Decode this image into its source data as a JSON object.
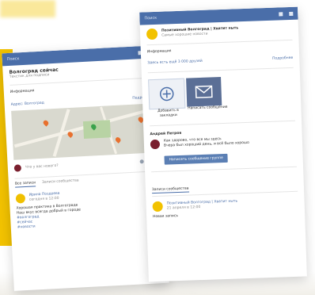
{
  "left_phone": {
    "topbar": {
      "search": "Поиск"
    },
    "community_title": "Волгоград сейчас",
    "community_subtitle": "Текстик для подписи",
    "info_label": "Информация",
    "address": "Адрес: Волгоград",
    "details_link": "Подробнее",
    "post_placeholder": "Что у вас нового?",
    "tabs": [
      "Все записи",
      "Записи сообщества"
    ],
    "post_author": "Ирина Поздеева",
    "post_time": "сегодня в 12:00",
    "post_lines": [
      "Хорошая практика в Волгограде",
      "Наш вкус всегда добрый в городе",
      "#волгоград",
      "#сейчас",
      "#новости"
    ],
    "colors": {
      "header": "#4a6ea9",
      "accent": "#f2c200"
    }
  },
  "right_phone": {
    "topbar": {
      "search": "Поиск"
    },
    "community_title": "Позитивный Волгоград | Хватит ныть",
    "community_subtitle": "Самые хорошие новости",
    "info_label": "Информация",
    "members_line": "Здесь есть ещё 3 000 друзей",
    "details_link": "Подробнее",
    "action_add": "Добавить в закладки",
    "action_message": "Написать сообщение",
    "comment_author": "Андрей Петров",
    "comment_lines": [
      "Как здорово, что все мы здесь",
      "Вчера был хороший день, и всё было хорошо"
    ],
    "comment_button": "Написать сообщение группе",
    "feed_tab": "Записи сообщества",
    "feed_post_author": "Позитивный Волгоград | Хватит ныть",
    "feed_post_time": "21 апреля в 12:00",
    "feed_post_text": "Новая запись",
    "colors": {
      "header": "#4a6ea9"
    }
  }
}
